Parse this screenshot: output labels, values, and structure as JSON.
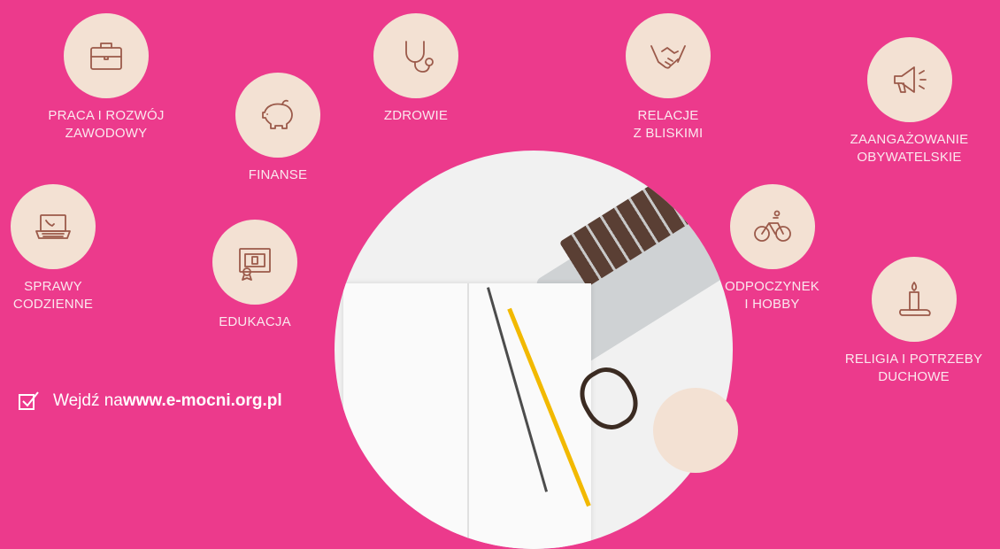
{
  "categories": {
    "work": {
      "icon": "briefcase-icon",
      "line1": "PRACA I ROZWÓJ",
      "line2": "ZAWODOWY"
    },
    "finance": {
      "icon": "piggy-bank-icon",
      "line1": "FINANSE"
    },
    "health": {
      "icon": "stethoscope-icon",
      "line1": "ZDROWIE"
    },
    "relations": {
      "icon": "handshake-icon",
      "line1": "RELACJE",
      "line2": "Z BLISKIMI"
    },
    "civic": {
      "icon": "megaphone-icon",
      "line1": "ZAANGAŻOWANIE",
      "line2": "OBYWATELSKIE"
    },
    "daily": {
      "icon": "laptop-phone-icon",
      "line1": "SPRAWY",
      "line2": "CODZIENNE"
    },
    "education": {
      "icon": "diploma-icon",
      "line1": "EDUKACJA"
    },
    "leisure": {
      "icon": "bicycle-icon",
      "line1": "ODPOCZYNEK",
      "line2": "I HOBBY"
    },
    "religion": {
      "icon": "candle-icon",
      "line1": "RELIGIA I POTRZEBY",
      "line2": "DUCHOWE"
    }
  },
  "cta": {
    "prefix": "Wejdź na ",
    "url": "www.e-mocni.org.pl"
  },
  "colors": {
    "background": "#ec3a8c",
    "circle": "#f3e1d3",
    "icon": "#9b5a4a"
  }
}
